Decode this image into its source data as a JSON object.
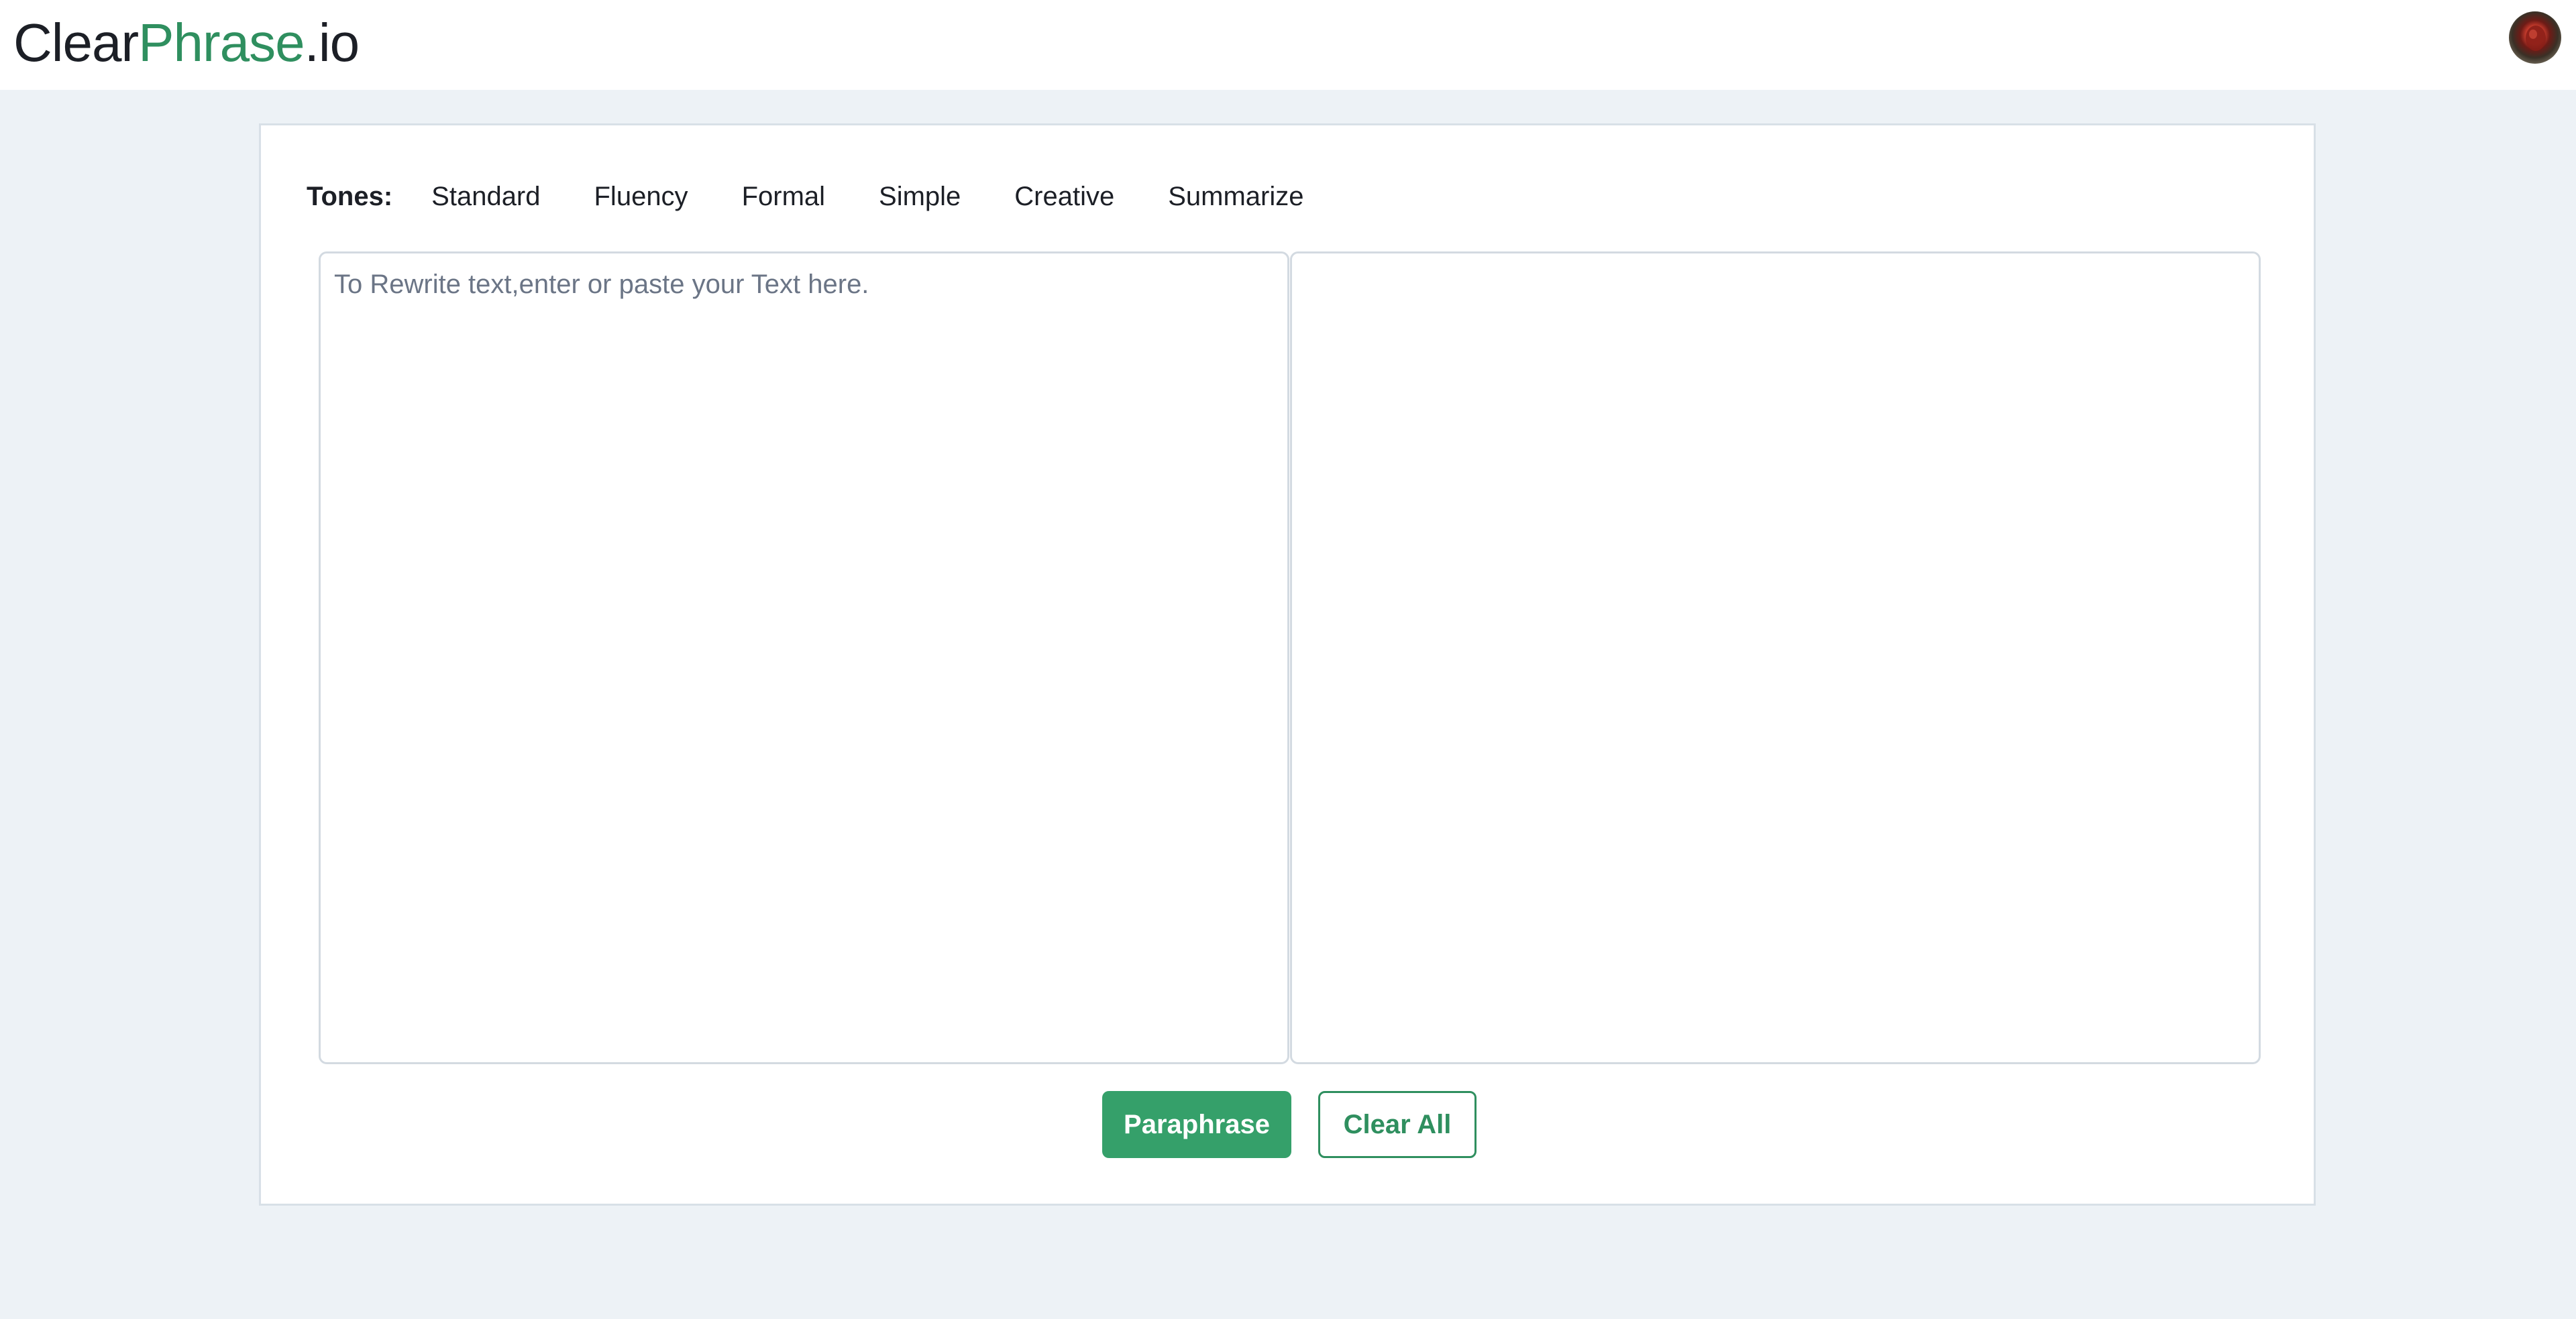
{
  "app": {
    "logo_part1": "Clear",
    "logo_part2": "Phrase",
    "logo_part3": ".io",
    "brand_color": "#2f8f5f"
  },
  "header": {
    "avatar_icon": "user-avatar-icon"
  },
  "tones": {
    "label": "Tones:",
    "options": [
      {
        "label": "Standard"
      },
      {
        "label": "Fluency"
      },
      {
        "label": "Formal"
      },
      {
        "label": "Simple"
      },
      {
        "label": "Creative"
      },
      {
        "label": "Summarize"
      }
    ]
  },
  "editor": {
    "input_placeholder": "To Rewrite text,enter or paste your Text here.",
    "input_value": "",
    "output_value": ""
  },
  "actions": {
    "paraphrase_label": "Paraphrase",
    "clear_label": "Clear All",
    "primary_color": "#35a06a"
  }
}
